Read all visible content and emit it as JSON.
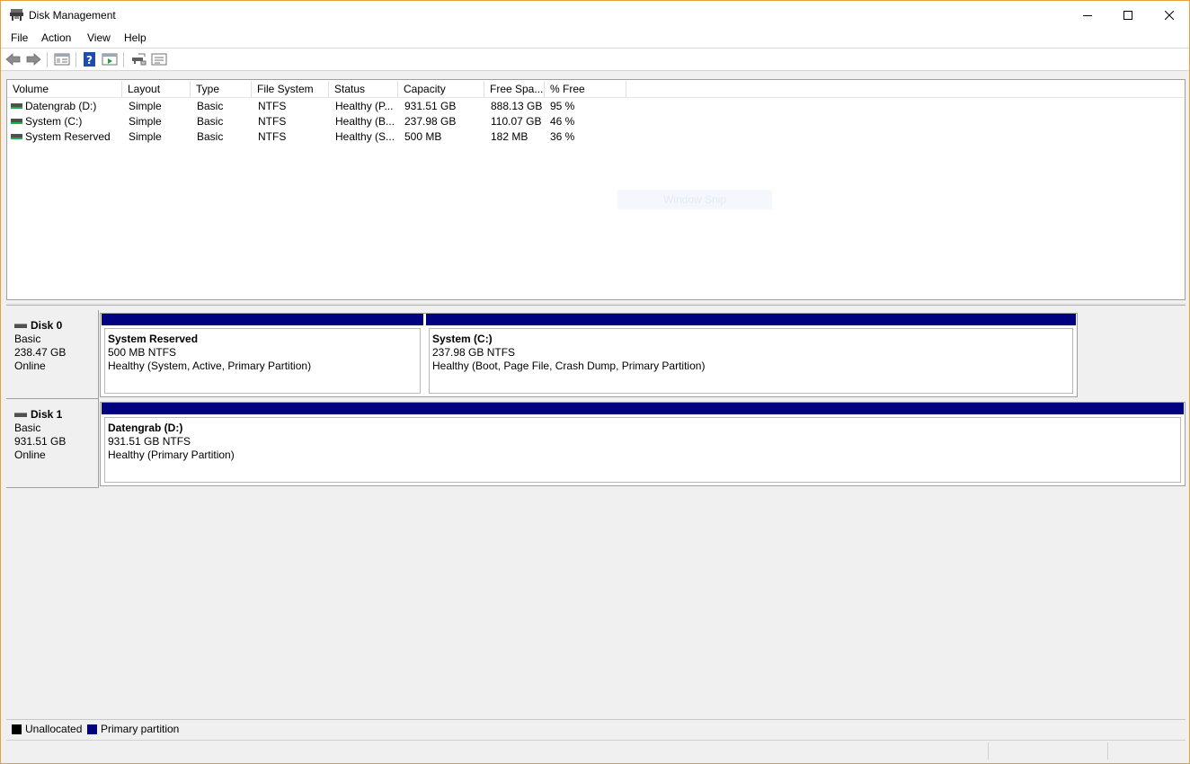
{
  "window": {
    "title": "Disk Management",
    "icon": "disk-management-icon",
    "controls": [
      "minimize-icon",
      "maximize-icon",
      "close-icon"
    ]
  },
  "menu": {
    "items": [
      "File",
      "Action",
      "View",
      "Help"
    ]
  },
  "toolbar": {
    "buttons": [
      "back-arrow-icon",
      "forward-arrow-icon",
      "show-hide-console-tree-icon",
      "help-icon",
      "properties-icon",
      "connect-disk-icon",
      "disk-list-icon"
    ]
  },
  "volume_list": {
    "columns": [
      "Volume",
      "Layout",
      "Type",
      "File System",
      "Status",
      "Capacity",
      "Free Spa...",
      "% Free"
    ],
    "rows": [
      [
        "Datengrab (D:)",
        "Simple",
        "Basic",
        "NTFS",
        "Healthy (P...",
        "931.51 GB",
        "888.13 GB",
        "95 %"
      ],
      [
        "System (C:)",
        "Simple",
        "Basic",
        "NTFS",
        "Healthy (B...",
        "237.98 GB",
        "110.07 GB",
        "46 %"
      ],
      [
        "System Reserved",
        "Simple",
        "Basic",
        "NTFS",
        "Healthy (S...",
        "500 MB",
        "182 MB",
        "36 %"
      ]
    ],
    "watermark": "Window Snip"
  },
  "disks": [
    {
      "name": "Disk 0",
      "type": "Basic",
      "size": "238.47 GB",
      "state": "Online",
      "partitions": [
        {
          "name": "System Reserved",
          "size": "500 MB NTFS",
          "status": "Healthy (System, Active, Primary Partition)"
        },
        {
          "name": "System  (C:)",
          "size": "237.98 GB NTFS",
          "status": "Healthy (Boot, Page File, Crash Dump, Primary Partition)"
        }
      ]
    },
    {
      "name": "Disk 1",
      "type": "Basic",
      "size": "931.51 GB",
      "state": "Online",
      "partitions": [
        {
          "name": "Datengrab  (D:)",
          "size": "931.51 GB NTFS",
          "status": "Healthy (Primary Partition)"
        }
      ]
    }
  ],
  "legend": {
    "unallocated": "Unallocated",
    "primary": "Primary partition",
    "unallocated_color": "#000000",
    "primary_color": "#000080"
  }
}
